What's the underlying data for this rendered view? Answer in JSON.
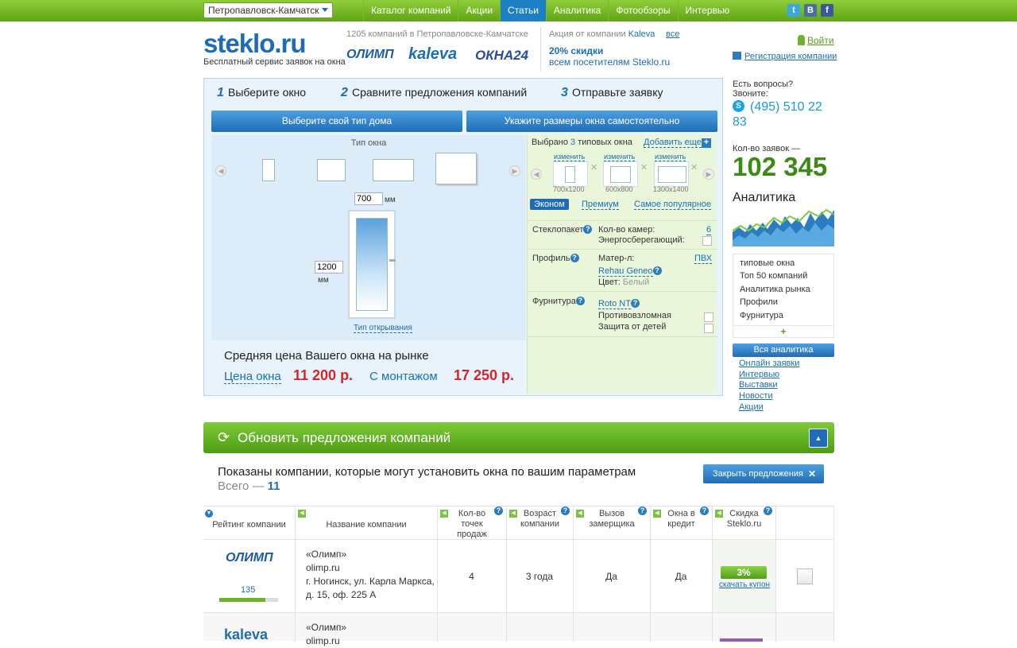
{
  "topbar": {
    "city": "Петропавловск-Камчатск",
    "nav": [
      "Каталог компаний",
      "Акции",
      "Статьи",
      "Аналитика",
      "Фотообзоры",
      "Интервью"
    ],
    "active_nav": "Статьи",
    "social": [
      "t",
      "B",
      "f"
    ]
  },
  "header": {
    "logo": "steklo.ru",
    "tagline": "Бесплатный сервис заявок на окна",
    "company_count": "1205 компаний в Петропавловске-Камчатске",
    "brands": [
      "ОЛИМП",
      "kaleva",
      "ОКНА24"
    ],
    "action_prefix": "Акция от компании",
    "action_company": "Kaleva",
    "action_all": "все",
    "action_title": "20% скидки",
    "action_text": "всем посетителям Steklo.ru",
    "login": "Войти",
    "register": "Регистрация компании"
  },
  "steps": [
    {
      "num": "1",
      "label": "Выберите окно"
    },
    {
      "num": "2",
      "label": "Сравните предложения компаний"
    },
    {
      "num": "3",
      "label": "Отправьте заявку"
    }
  ],
  "buttons": {
    "house_type": "Выберите свой тип дома",
    "sizes": "Укажите размеры окна самостоятельно"
  },
  "window_picker": {
    "title": "Тип окна",
    "width_value": "700",
    "height_value": "1200",
    "unit": "мм",
    "opening_type": "Тип открывания"
  },
  "price": {
    "title": "Средняя цена Вашего окна на рынке",
    "window_label": "Цена окна",
    "window_price": "11 200 р.",
    "install_label": "С монтажом",
    "install_price": "17 250 р."
  },
  "selected": {
    "prefix": "Выбрано",
    "count": "3",
    "suffix": "типовых окна",
    "add_more": "Добавить еще",
    "change": "изменить",
    "sizes": [
      "700x1200",
      "600x800",
      "1300x1400"
    ],
    "tabs": [
      "Эконом",
      "Премиум",
      "Самое популярное"
    ],
    "active_tab": "Эконом"
  },
  "specs": {
    "glass_label": "Стеклопакет",
    "chambers_label": "Кол-во камер:",
    "chambers_value": "6",
    "energy_label": "Энергосберегающий:",
    "profile_label": "Профиль",
    "material_label": "Матер-л:",
    "material_value": "ПВХ",
    "profile_name": "Rehau Geneo",
    "color_label": "Цвет:",
    "color_value": "Белый",
    "fittings_label": "Фурнитура",
    "fittings_name": "Roto NT",
    "burglar_label": "Противовзломная",
    "child_label": "Защита от детей"
  },
  "sidebar": {
    "questions": "Есть вопросы?",
    "call": "Звоните:",
    "phone_a": "(495) 510 22",
    "phone_b": "83",
    "requests_label": "Кол-во заявок —",
    "requests_count": "102 345",
    "analytics_title": "Аналитика",
    "analytics_items": [
      "типовые окна",
      "Топ 50 компаний",
      "Аналитика рынка",
      "Профили",
      "Фурнитура"
    ],
    "plus": "+",
    "all_analytics": "Вся аналитика",
    "links": [
      "Онлайн заявки",
      "Интервью",
      "Выставки",
      "Новости",
      "Акции"
    ]
  },
  "offers": {
    "update": "Обновить предложения компаний",
    "shown": "Показаны компании, которые могут установить окна по вашим параметрам",
    "total_label": "Всего —",
    "total": "11",
    "close": "Закрыть предложения"
  },
  "table": {
    "headers": [
      "Рейтинг компании",
      "Название компании",
      "Кол-во точек продаж",
      "Возраст компании",
      "Вызов замерщика",
      "Окна в кредит",
      "Скидка Steklo.ru"
    ],
    "rows": [
      {
        "logo": "ОЛИМП",
        "rating": "135",
        "name": "«Олимп»",
        "site": "olimp.ru",
        "addr1": "г. Ногинск, ул. Карла Маркса,",
        "addr2": "д. 15, оф. 225 А",
        "points": "4",
        "age": "3 года",
        "measurer": "Да",
        "credit": "Да",
        "discount": "3%",
        "coupon": "скачать купон"
      },
      {
        "logo": "kaleva",
        "name": "«Олимп»",
        "site": "olimp.ru"
      }
    ]
  },
  "colors": {
    "green": "#5fa414",
    "blue": "#1d6cb4",
    "red": "#d8232a"
  }
}
